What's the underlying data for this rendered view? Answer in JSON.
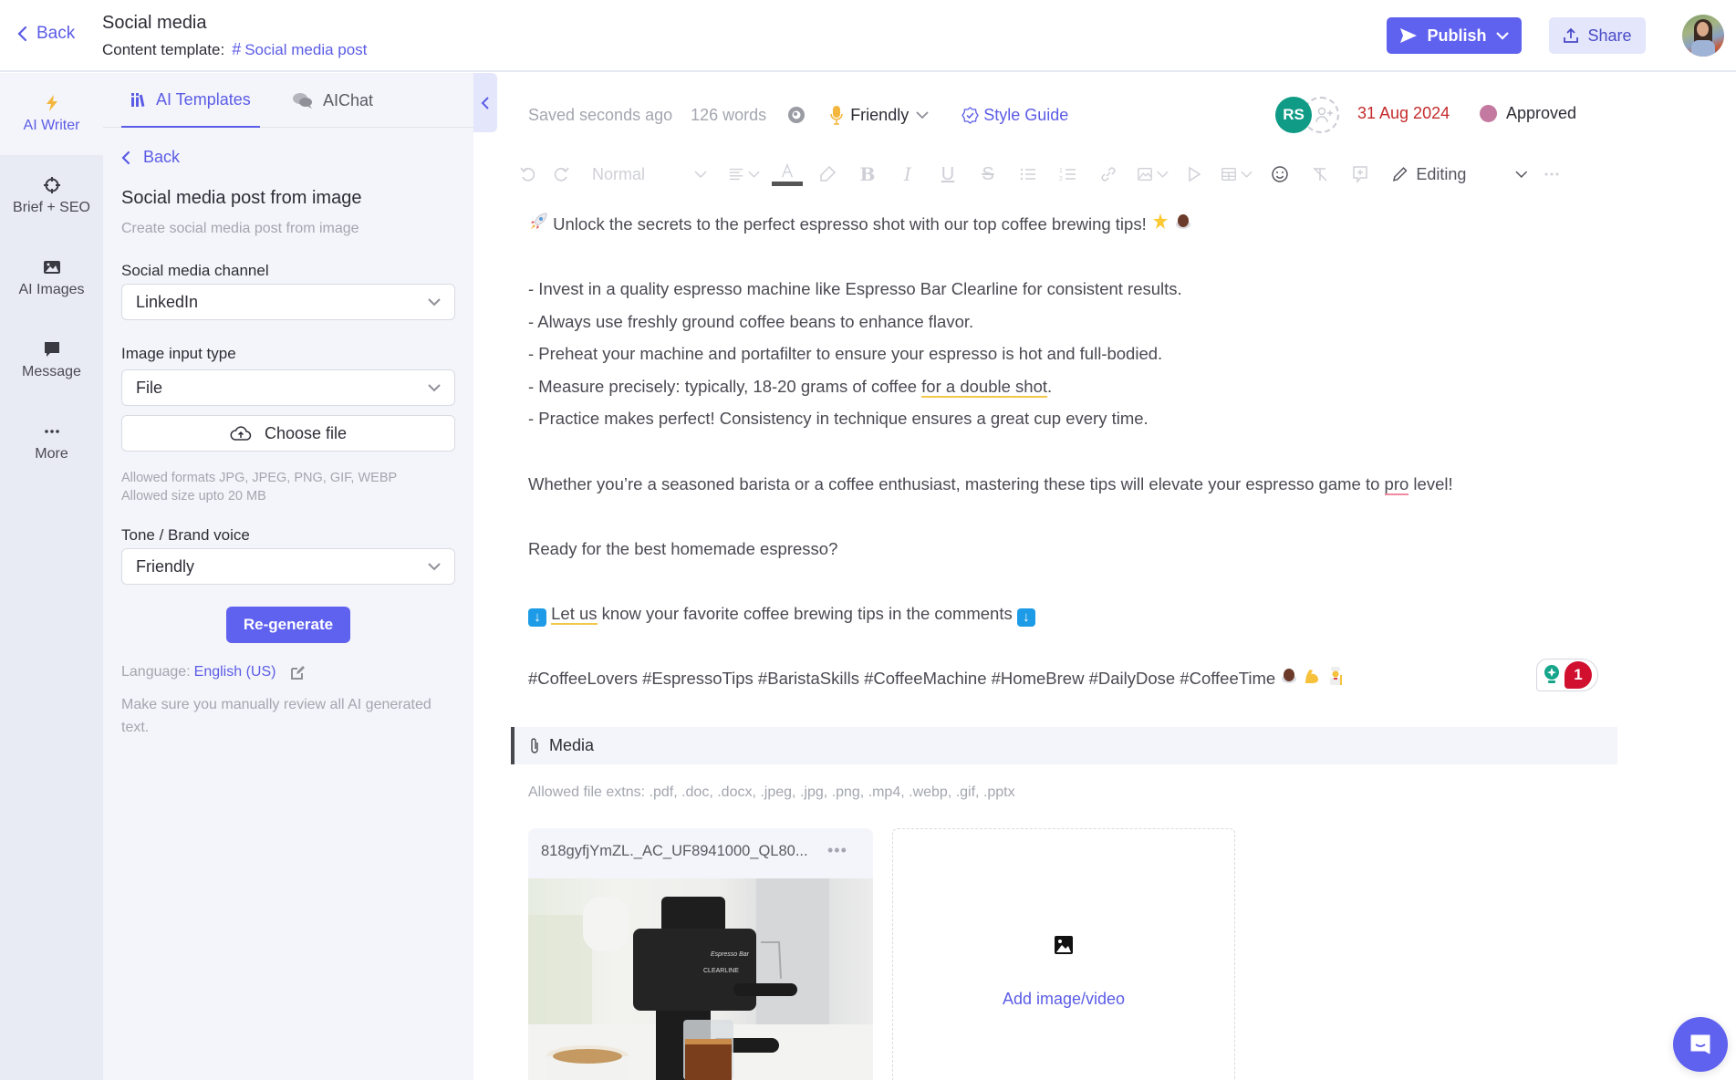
{
  "header": {
    "back_label": "Back",
    "title": "Social media",
    "subtitle_label": "Content template:",
    "template_name": "Social media post",
    "publish_label": "Publish",
    "share_label": "Share"
  },
  "rail": {
    "items": [
      {
        "label": "AI Writer",
        "icon": "lightning-icon",
        "active": true
      },
      {
        "label": "Brief + SEO",
        "icon": "crosshair-icon"
      },
      {
        "label": "AI Images",
        "icon": "image-icon"
      },
      {
        "label": "Message",
        "icon": "message-icon"
      },
      {
        "label": "More",
        "icon": "more-icon"
      }
    ]
  },
  "panel": {
    "tabs": [
      {
        "label": "AI Templates",
        "active": true
      },
      {
        "label": "AIChat"
      }
    ],
    "back_label": "Back",
    "title": "Social media post from image",
    "description": "Create social media post from image",
    "channel_label": "Social media channel",
    "channel_value": "LinkedIn",
    "input_type_label": "Image input type",
    "input_type_value": "File",
    "choose_file_label": "Choose file",
    "allowed_formats": "Allowed formats JPG, JPEG, PNG, GIF, WEBP",
    "allowed_size": "Allowed size upto 20 MB",
    "tone_label": "Tone / Brand voice",
    "tone_value": "Friendly",
    "regenerate_label": "Re-generate",
    "language_label": "Language:",
    "language_value": "English (US)",
    "review_note": "Make sure you manually review all AI generated text."
  },
  "editor": {
    "saved_status": "Saved seconds ago",
    "word_count": "126 words",
    "tone": "Friendly",
    "style_guide_label": "Style Guide",
    "assignee_initials": "RS",
    "due_date": "31 Aug 2024",
    "stage": "Approved",
    "stage_color": "#c47aa0",
    "toolbar": {
      "paragraph_style": "Normal",
      "mode": "Editing"
    },
    "content": {
      "line1": "Unlock the secrets to the perfect espresso shot with our top coffee brewing tips!",
      "bullet1": "- Invest in a quality espresso machine like Espresso Bar Clearline for consistent results.",
      "bullet2": "- Always use freshly ground coffee beans to enhance flavor.",
      "bullet3": "- Preheat your machine and portafilter to ensure your espresso is hot and full-bodied.",
      "bullet4_pre": "- Measure precisely: typically, 18-20 grams of coffee ",
      "bullet4_flag": "for a double shot",
      "bullet4_post": ".",
      "bullet5": "- Practice makes perfect! Consistency in technique ensures a great cup every time.",
      "para_pre": "Whether you’re a seasoned barista or a coffee enthusiast, mastering these tips will elevate your espresso game to ",
      "para_flag": "pro",
      "para_post": " level!",
      "question": "Ready for the best homemade espresso?",
      "cta_flag": "Let us",
      "cta_post": " know your favorite coffee brewing tips in the comments",
      "hashtags": "#CoffeeLovers #EspressoTips #BaristaSkills #CoffeeMachine #HomeBrew #DailyDose #CoffeeTime"
    },
    "suggestion_count": "1"
  },
  "media": {
    "section_label": "Media",
    "allowed_extensions": "Allowed file extns: .pdf, .doc, .docx, .jpeg, .jpg, .png, .mp4, .webp, .gif, .pptx",
    "files": [
      {
        "name": "818gyfjYmZL._AC_UF8941000_QL80..."
      }
    ],
    "add_label": "Add image/video"
  }
}
